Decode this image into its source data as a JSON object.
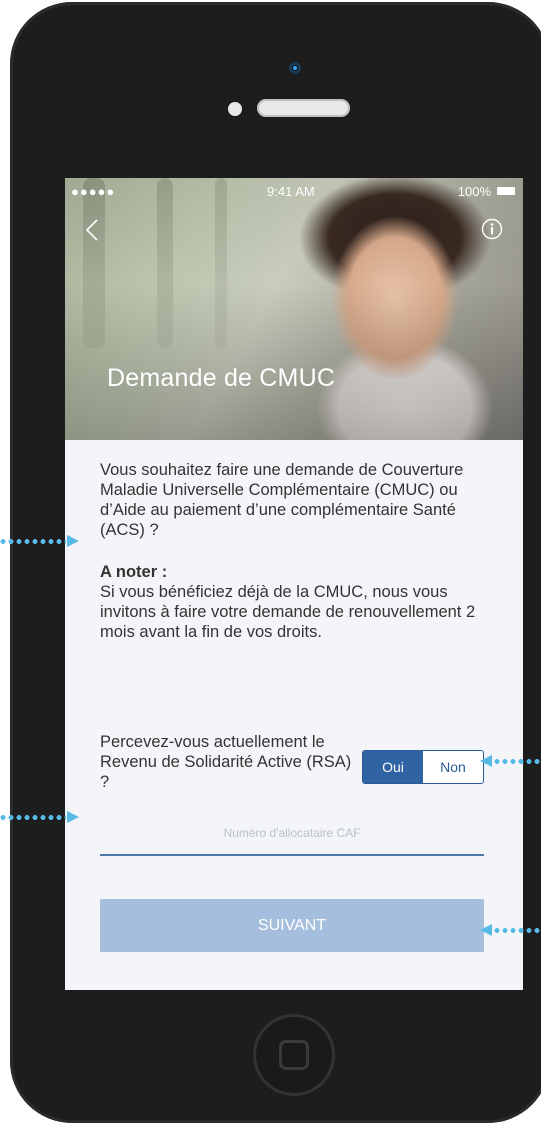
{
  "status_bar": {
    "carrier": "●●●●● ",
    "time": "9:41 AM",
    "battery": "100%"
  },
  "header": {
    "title": "Demande de CMUC"
  },
  "content": {
    "intro": "Vous souhaitez faire une demande de Couverture Maladie Universelle Complémentaire (CMUC) ou d’Aide au paiement d’une complémentaire Santé (ACS) ?",
    "note_title": "A noter :",
    "note_body": "Si vous bénéficiez déjà de la CMUC, nous vous invitons à faire votre demande de renouvellement 2 mois avant la fin de vos droits."
  },
  "rsa": {
    "question": "Percevez-vous actuellement le Revenu de Solidarité Active (RSA) ?",
    "yes_label": "Oui",
    "no_label": "Non",
    "selected": "Oui"
  },
  "caf_field": {
    "placeholder": "Numéro d'allocataire CAF",
    "value": ""
  },
  "next_button": {
    "label": "SUIVANT"
  },
  "colors": {
    "primary": "#2f63a3",
    "button_disabled": "#a6bede",
    "annotation_arrow": "#57b9e6",
    "phone_body": "#1d1d1d"
  }
}
